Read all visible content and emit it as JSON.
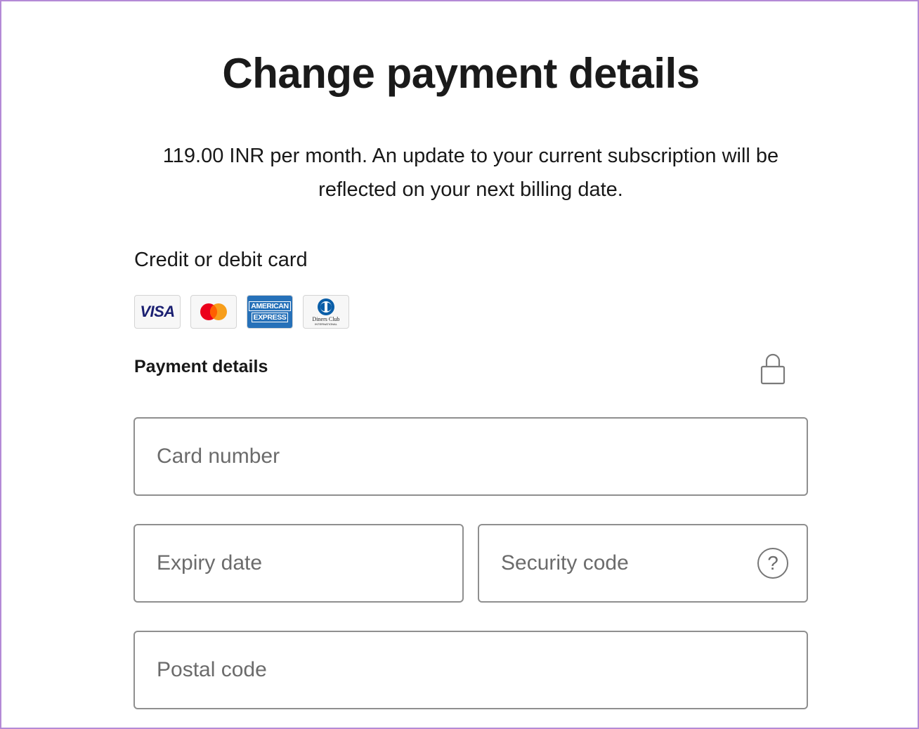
{
  "header": {
    "title": "Change payment details",
    "subtitle": "119.00 INR per month. An update to your current subscription will be reflected on your next billing date."
  },
  "payment_method": {
    "label": "Credit or debit card",
    "cards": [
      {
        "name": "visa",
        "text": "VISA"
      },
      {
        "name": "mastercard"
      },
      {
        "name": "american-express",
        "line1": "AMERICAN",
        "line2": "EXPRESS"
      },
      {
        "name": "diners-club",
        "line1": "Diners Club",
        "line2": "INTERNATIONAL"
      }
    ]
  },
  "form": {
    "section_label": "Payment details",
    "lock_icon": "lock-icon",
    "card_number": {
      "placeholder": "Card number",
      "value": ""
    },
    "expiry_date": {
      "placeholder": "Expiry date",
      "value": ""
    },
    "security_code": {
      "placeholder": "Security code",
      "value": "",
      "help_icon": "question-mark-icon",
      "help_text": "?"
    },
    "postal_code": {
      "placeholder": "Postal code",
      "value": ""
    }
  },
  "colors": {
    "frame_border": "#b48ad6",
    "field_border": "#8f8f8f",
    "amex_blue": "#2671b9",
    "visa_blue": "#1a1f71",
    "mastercard_red": "#eb001b",
    "mastercard_orange": "#f79e1b"
  }
}
